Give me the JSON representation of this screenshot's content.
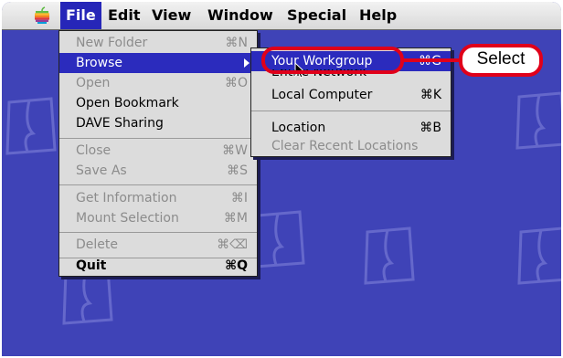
{
  "menubar": {
    "apple_icon": "apple-icon",
    "items": [
      "File",
      "Edit",
      "View",
      "Window",
      "Special",
      "Help"
    ],
    "active_item": "File"
  },
  "file_menu": {
    "items": [
      {
        "label": "New Folder",
        "shortcut": "⌘N",
        "enabled": false
      },
      {
        "label": "Browse",
        "shortcut": "",
        "enabled": true,
        "highlighted": true,
        "submenu": true
      },
      {
        "label": "Open",
        "shortcut": "⌘O",
        "enabled": false
      },
      {
        "label": "Open Bookmark",
        "shortcut": "",
        "enabled": true
      },
      {
        "label": "DAVE Sharing",
        "shortcut": "",
        "enabled": true
      },
      {
        "label": "Close",
        "shortcut": "⌘W",
        "enabled": false
      },
      {
        "label": "Save As",
        "shortcut": "⌘S",
        "enabled": false
      },
      {
        "label": "Get Information",
        "shortcut": "⌘I",
        "enabled": false
      },
      {
        "label": "Mount Selection",
        "shortcut": "⌘M",
        "enabled": false
      },
      {
        "label": "Delete",
        "shortcut": "⌘⌫",
        "enabled": false
      },
      {
        "label": "Quit",
        "shortcut": "⌘Q",
        "enabled": true
      }
    ]
  },
  "browse_submenu": {
    "items": [
      {
        "label": "Your Workgroup",
        "shortcut": "⌘G",
        "enabled": true,
        "highlighted": true
      },
      {
        "label": "Entire Network",
        "shortcut": "",
        "enabled": true
      },
      {
        "label": "Local Computer",
        "shortcut": "⌘K",
        "enabled": true
      },
      {
        "label": "Location",
        "shortcut": "⌘B",
        "enabled": true
      },
      {
        "label": "Clear Recent Locations",
        "shortcut": "",
        "enabled": false
      }
    ]
  },
  "callout": {
    "text": "Select"
  },
  "colors": {
    "desktop": "#3f43b7",
    "highlight": "#2b2bbd",
    "callout_border": "#e0001a"
  }
}
